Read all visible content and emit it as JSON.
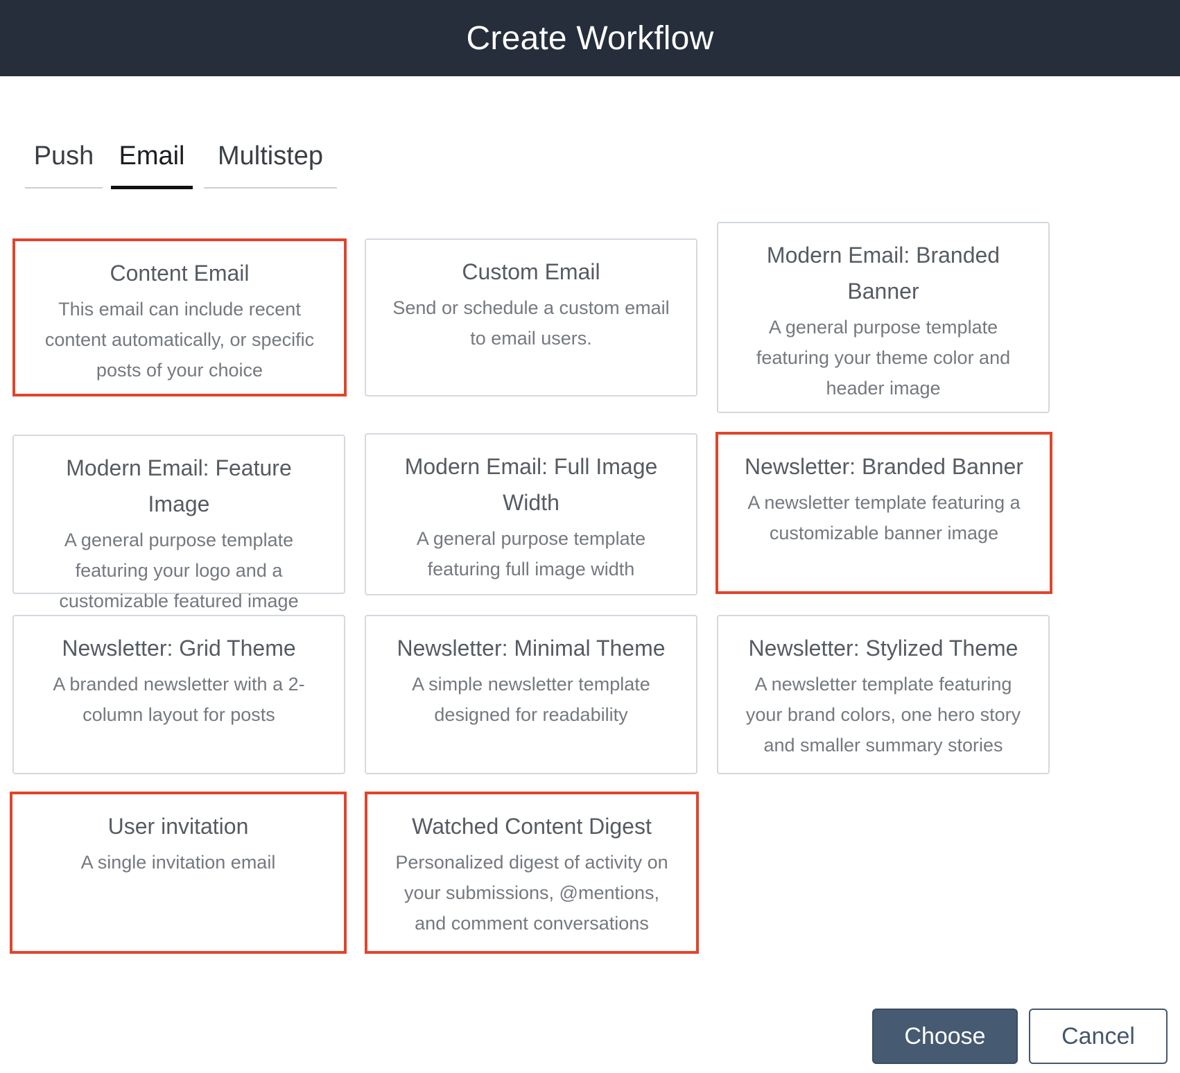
{
  "header": {
    "title": "Create Workflow"
  },
  "tabs": [
    {
      "label": "Push",
      "active": false
    },
    {
      "label": "Email",
      "active": true
    },
    {
      "label": "Multistep",
      "active": false
    }
  ],
  "templates": [
    {
      "title": "Content Email",
      "description": "This email can include recent content automatically, or specific posts of your choice",
      "highlighted": true
    },
    {
      "title": "Custom Email",
      "description": "Send or schedule a custom email to email users.",
      "highlighted": false
    },
    {
      "title": "Modern Email: Branded Banner",
      "description": "A general purpose template featuring your theme color and header image",
      "highlighted": false
    },
    {
      "title": "Modern Email: Feature Image",
      "description": "A general purpose template featuring your logo and a customizable featured image",
      "highlighted": false
    },
    {
      "title": "Modern Email: Full Image Width",
      "description": "A general purpose template featuring full image width",
      "highlighted": false
    },
    {
      "title": "Newsletter: Branded Banner",
      "description": "A newsletter template featuring a customizable banner image",
      "highlighted": true
    },
    {
      "title": "Newsletter: Grid Theme",
      "description": "A branded newsletter with a 2-column layout for posts",
      "highlighted": false
    },
    {
      "title": "Newsletter: Minimal Theme",
      "description": "A simple newsletter template designed for readability",
      "highlighted": false
    },
    {
      "title": "Newsletter: Stylized Theme",
      "description": "A newsletter template featuring your brand colors, one hero story and smaller summary stories",
      "highlighted": false
    },
    {
      "title": "User invitation",
      "description": "A single invitation email",
      "highlighted": true
    },
    {
      "title": "Watched Content Digest",
      "description": "Personalized digest of activity on your submissions, @mentions, and comment conversations",
      "highlighted": true
    }
  ],
  "footer": {
    "choose_label": "Choose",
    "cancel_label": "Cancel"
  },
  "colors": {
    "header_bg": "#262e3b",
    "highlight": "#e0452c",
    "primary_button": "#465a72"
  }
}
